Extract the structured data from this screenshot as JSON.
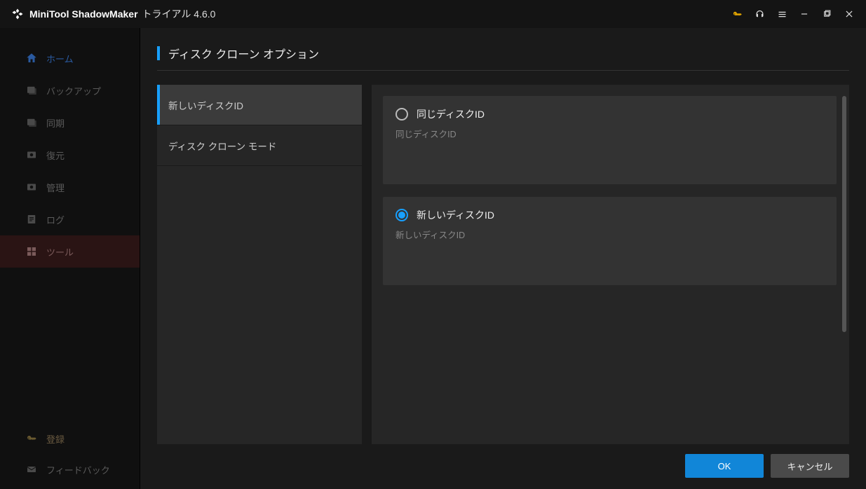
{
  "titlebar": {
    "app_name": "MiniTool ShadowMaker",
    "edition_version": "トライアル 4.6.0"
  },
  "sidebar": {
    "items": [
      {
        "label": "ホーム"
      },
      {
        "label": "バックアップ"
      },
      {
        "label": "同期"
      },
      {
        "label": "復元"
      },
      {
        "label": "管理"
      },
      {
        "label": "ログ"
      },
      {
        "label": "ツール"
      }
    ],
    "bottom": [
      {
        "label": "登録"
      },
      {
        "label": "フィードバック"
      }
    ]
  },
  "page": {
    "title": "ディスク クローン オプション"
  },
  "tabs": [
    {
      "label": "新しいディスクID"
    },
    {
      "label": "ディスク クローン モード"
    }
  ],
  "options": [
    {
      "title": "同じディスクID",
      "desc": "同じディスクID",
      "selected": false
    },
    {
      "title": "新しいディスクID",
      "desc": "新しいディスクID",
      "selected": true
    }
  ],
  "buttons": {
    "ok": "OK",
    "cancel": "キャンセル"
  }
}
